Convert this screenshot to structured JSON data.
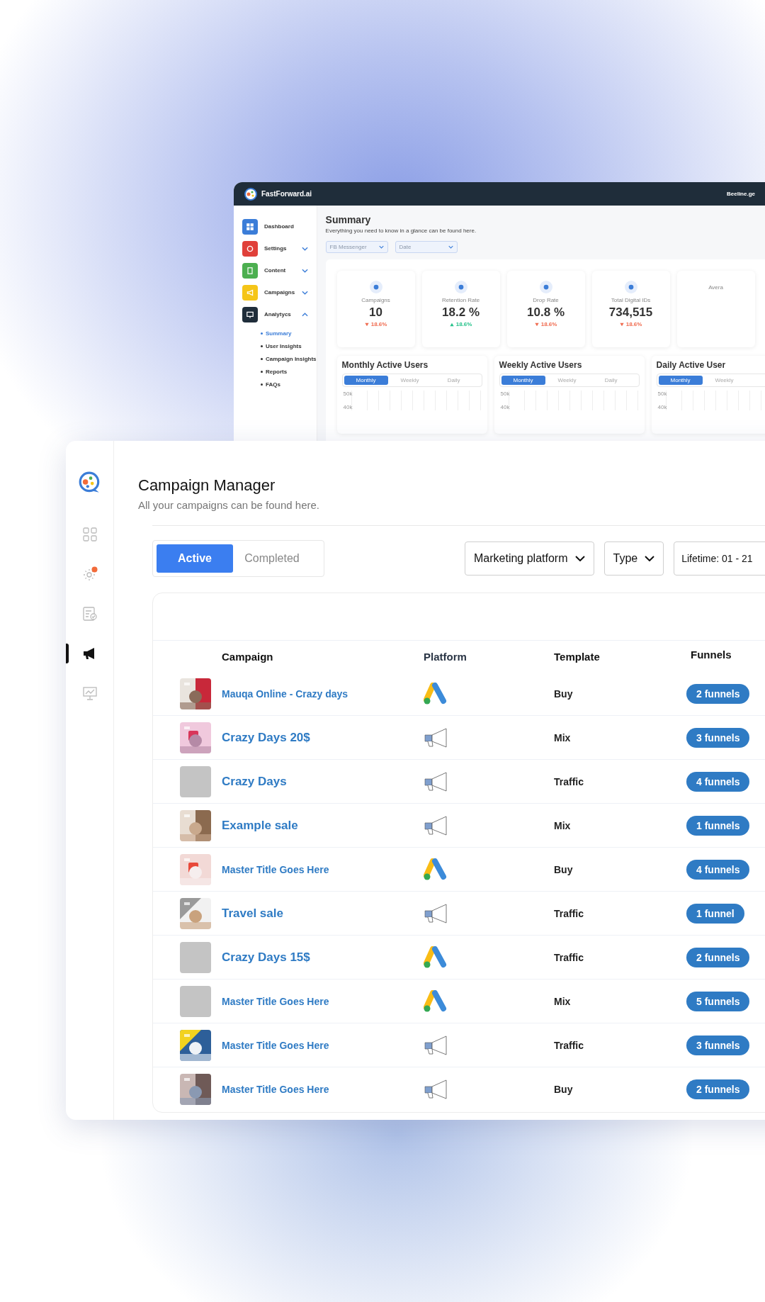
{
  "back_window": {
    "brand": "FastForward.ai",
    "account": "Beeline.ge",
    "sidebar": {
      "items": [
        {
          "label": "Dashboard",
          "color": "#3b7dd8",
          "kind": "grid"
        },
        {
          "label": "Settings",
          "color": "#e0403a",
          "kind": "gear",
          "expanded": false,
          "chevron": true
        },
        {
          "label": "Content",
          "color": "#4caf50",
          "kind": "doc",
          "expanded": false,
          "chevron": true
        },
        {
          "label": "Campaigns",
          "color": "#f5c518",
          "kind": "megaphone",
          "expanded": false,
          "chevron": true
        },
        {
          "label": "Analytycs",
          "color": "#1f2d3a",
          "kind": "board",
          "expanded": true,
          "chevron": true,
          "children": [
            {
              "label": "Summary",
              "selected": true
            },
            {
              "label": "User Insights",
              "selected": false
            },
            {
              "label": "Campaign Insights",
              "selected": false
            },
            {
              "label": "Reports",
              "selected": false
            },
            {
              "label": "FAQs",
              "selected": false
            }
          ]
        }
      ]
    },
    "title": "Summary",
    "subtitle": "Everything you need to know in a glance can be found here.",
    "filters": [
      {
        "placeholder": "FB Messenger"
      },
      {
        "placeholder": "Date"
      }
    ],
    "kpis": [
      {
        "label": "Campaigns",
        "value": "10",
        "change": "18.6%",
        "rising": false
      },
      {
        "label": "Retention Rate",
        "value": "18.2 %",
        "change": "18.6%",
        "rising": true
      },
      {
        "label": "Drop Rate",
        "value": "10.8 %",
        "change": "18.6%",
        "rising": false
      },
      {
        "label": "Total Digital IDs",
        "value": "734,515",
        "change": "18.6%",
        "rising": false
      },
      {
        "label": "Avera"
      }
    ],
    "charts": [
      {
        "title": "Monthly Active Users",
        "tabs": [
          {
            "label": "Monthly",
            "selected": true
          },
          {
            "label": "Weekly",
            "selected": false
          },
          {
            "label": "Daily",
            "selected": false
          }
        ],
        "ticks": [
          "50k",
          "40k"
        ]
      },
      {
        "title": "Weekly Active Users",
        "tabs": [
          {
            "label": "Monthly",
            "selected": true
          },
          {
            "label": "Weekly",
            "selected": false
          },
          {
            "label": "Daily",
            "selected": false
          }
        ],
        "ticks": [
          "50k",
          "40k"
        ]
      },
      {
        "title": "Daily Active User",
        "tabs": [
          {
            "label": "Monthly",
            "selected": true
          },
          {
            "label": "Weekly",
            "selected": false
          }
        ],
        "ticks": [
          "50k",
          "40k"
        ]
      }
    ]
  },
  "front_window": {
    "nav": [
      {
        "kind": "grid",
        "selected": false,
        "badge": false
      },
      {
        "kind": "gear",
        "selected": false,
        "badge": true
      },
      {
        "kind": "checklist",
        "selected": false,
        "badge": false
      },
      {
        "kind": "megaphone",
        "selected": true,
        "badge": false
      },
      {
        "kind": "board",
        "selected": false,
        "badge": false
      }
    ],
    "title": "Campaign Manager",
    "subtitle": "All your campaigns can be found here.",
    "tabs": [
      {
        "label": "Active",
        "selected": true
      },
      {
        "label": "Completed",
        "selected": false
      }
    ],
    "filters": [
      "Marketing platform",
      "Type",
      "Lifetime: 01 - 21"
    ],
    "table": {
      "columns": [
        "Campaign",
        "Platform",
        "Template",
        "Funnels"
      ],
      "rows": [
        {
          "name": "Mauqa Online - Crazy days",
          "large": false,
          "platform": {
            "kind": "google-ads"
          },
          "template": "Buy",
          "funnels": "2 funnels"
        },
        {
          "name": "Crazy Days 20$",
          "large": true,
          "platform": {
            "kind": "megaphone"
          },
          "template": "Mix",
          "funnels": "3 funnels"
        },
        {
          "thumb": {
            "kind": "blank"
          },
          "name": "Crazy Days",
          "large": true,
          "platform": {
            "kind": "megaphone"
          },
          "template": "Traffic",
          "funnels": "4 funnels"
        },
        {
          "name": "Example sale",
          "large": true,
          "platform": {
            "kind": "megaphone"
          },
          "template": "Mix",
          "funnels": "1 funnels"
        },
        {
          "name": "Master Title Goes Here",
          "large": false,
          "platform": {
            "kind": "google-ads"
          },
          "template": "Buy",
          "funnels": "4 funnels"
        },
        {
          "name": "Travel sale",
          "large": true,
          "platform": {
            "kind": "megaphone"
          },
          "template": "Traffic",
          "funnels": "1 funnel"
        },
        {
          "thumb": {
            "kind": "blank"
          },
          "name": "Crazy Days 15$",
          "large": true,
          "platform": {
            "kind": "google-ads"
          },
          "template": "Traffic",
          "funnels": "2 funnels"
        },
        {
          "thumb": {
            "kind": "blank"
          },
          "name": "Master Title Goes Here",
          "large": false,
          "platform": {
            "kind": "google-ads"
          },
          "template": "Mix",
          "funnels": "5 funnels"
        },
        {
          "name": "Master Title Goes Here",
          "large": false,
          "platform": {
            "kind": "megaphone"
          },
          "template": "Traffic",
          "funnels": "3 funnels"
        },
        {
          "name": "Master Title Goes Here",
          "large": false,
          "platform": {
            "kind": "megaphone"
          },
          "template": "Buy",
          "funnels": "2 funnels"
        }
      ]
    }
  }
}
